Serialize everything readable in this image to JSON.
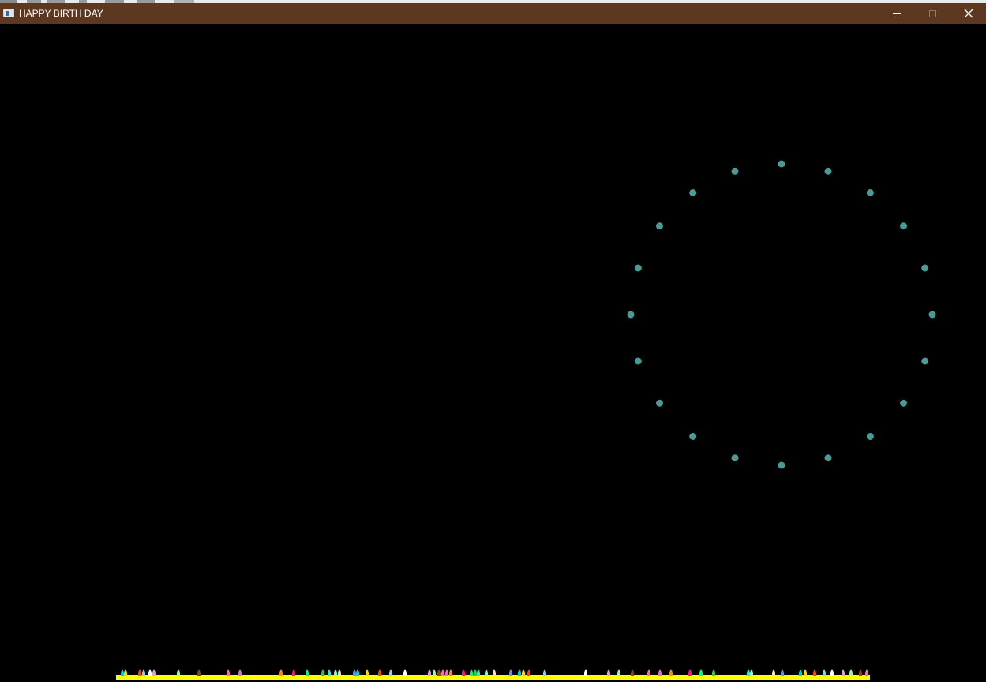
{
  "window": {
    "title": "HAPPY BIRTH DAY",
    "controls": {
      "minimize_icon": "minimize-icon",
      "maximize_icon": "maximize-icon",
      "close_icon": "close-icon"
    },
    "titlebar_color": "#5c3820"
  },
  "scene": {
    "background_color": "#000000",
    "firework": {
      "spark_count": 20,
      "spark_color": "#4a9a95"
    },
    "ground": {
      "color": "#ffff00"
    },
    "candle_colors": [
      "#7fffd4",
      "#ff8c00",
      "#dda0dd",
      "#00ced1",
      "#32cd32",
      "#ff69b4",
      "#87cefa",
      "#f5deb3",
      "#ff1493",
      "#98fb98",
      "#ffd700",
      "#40e0d0",
      "#da70d6",
      "#ffffff",
      "#6495ed",
      "#00ff7f",
      "#8b4513",
      "#ff4500"
    ]
  }
}
